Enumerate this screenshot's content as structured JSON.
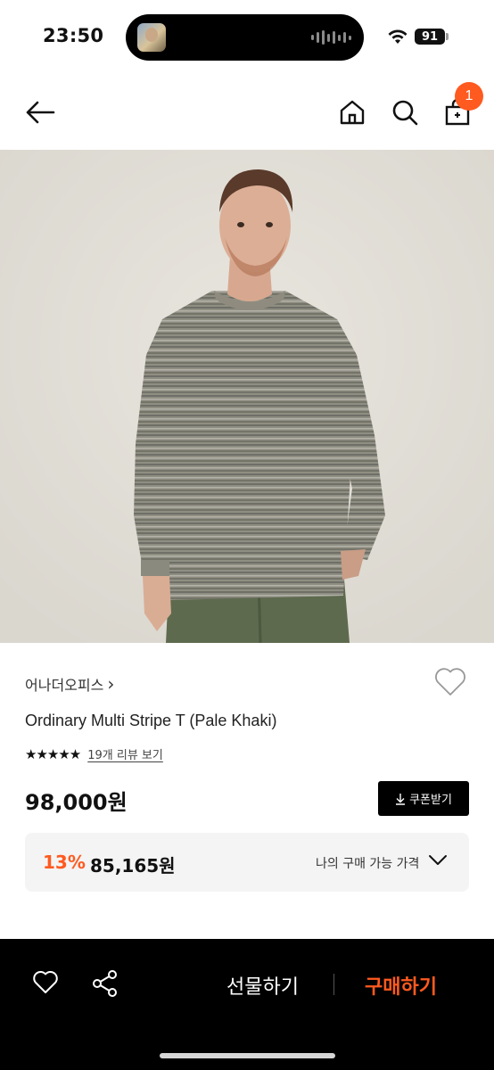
{
  "status_bar": {
    "time": "23:50",
    "battery": "91"
  },
  "nav": {
    "cart_count": "1"
  },
  "product": {
    "brand": "어나더오피스",
    "brand_arrow": "›",
    "name": "Ordinary Multi Stripe T (Pale Khaki)",
    "stars": "★★★★★",
    "review_link": "19개 리뷰 보기",
    "price": "98,000원",
    "coupon_label": "쿠폰받기",
    "discount_rate": "13%",
    "discount_price": "85,165원",
    "discount_label": "나의 구매 가능 가격"
  },
  "bottom_bar": {
    "gift_label": "선물하기",
    "buy_label": "구매하기"
  },
  "colors": {
    "accent": "#ff5a1f",
    "bottom_bar": "#000000",
    "image_bg": "#e4e1da"
  }
}
